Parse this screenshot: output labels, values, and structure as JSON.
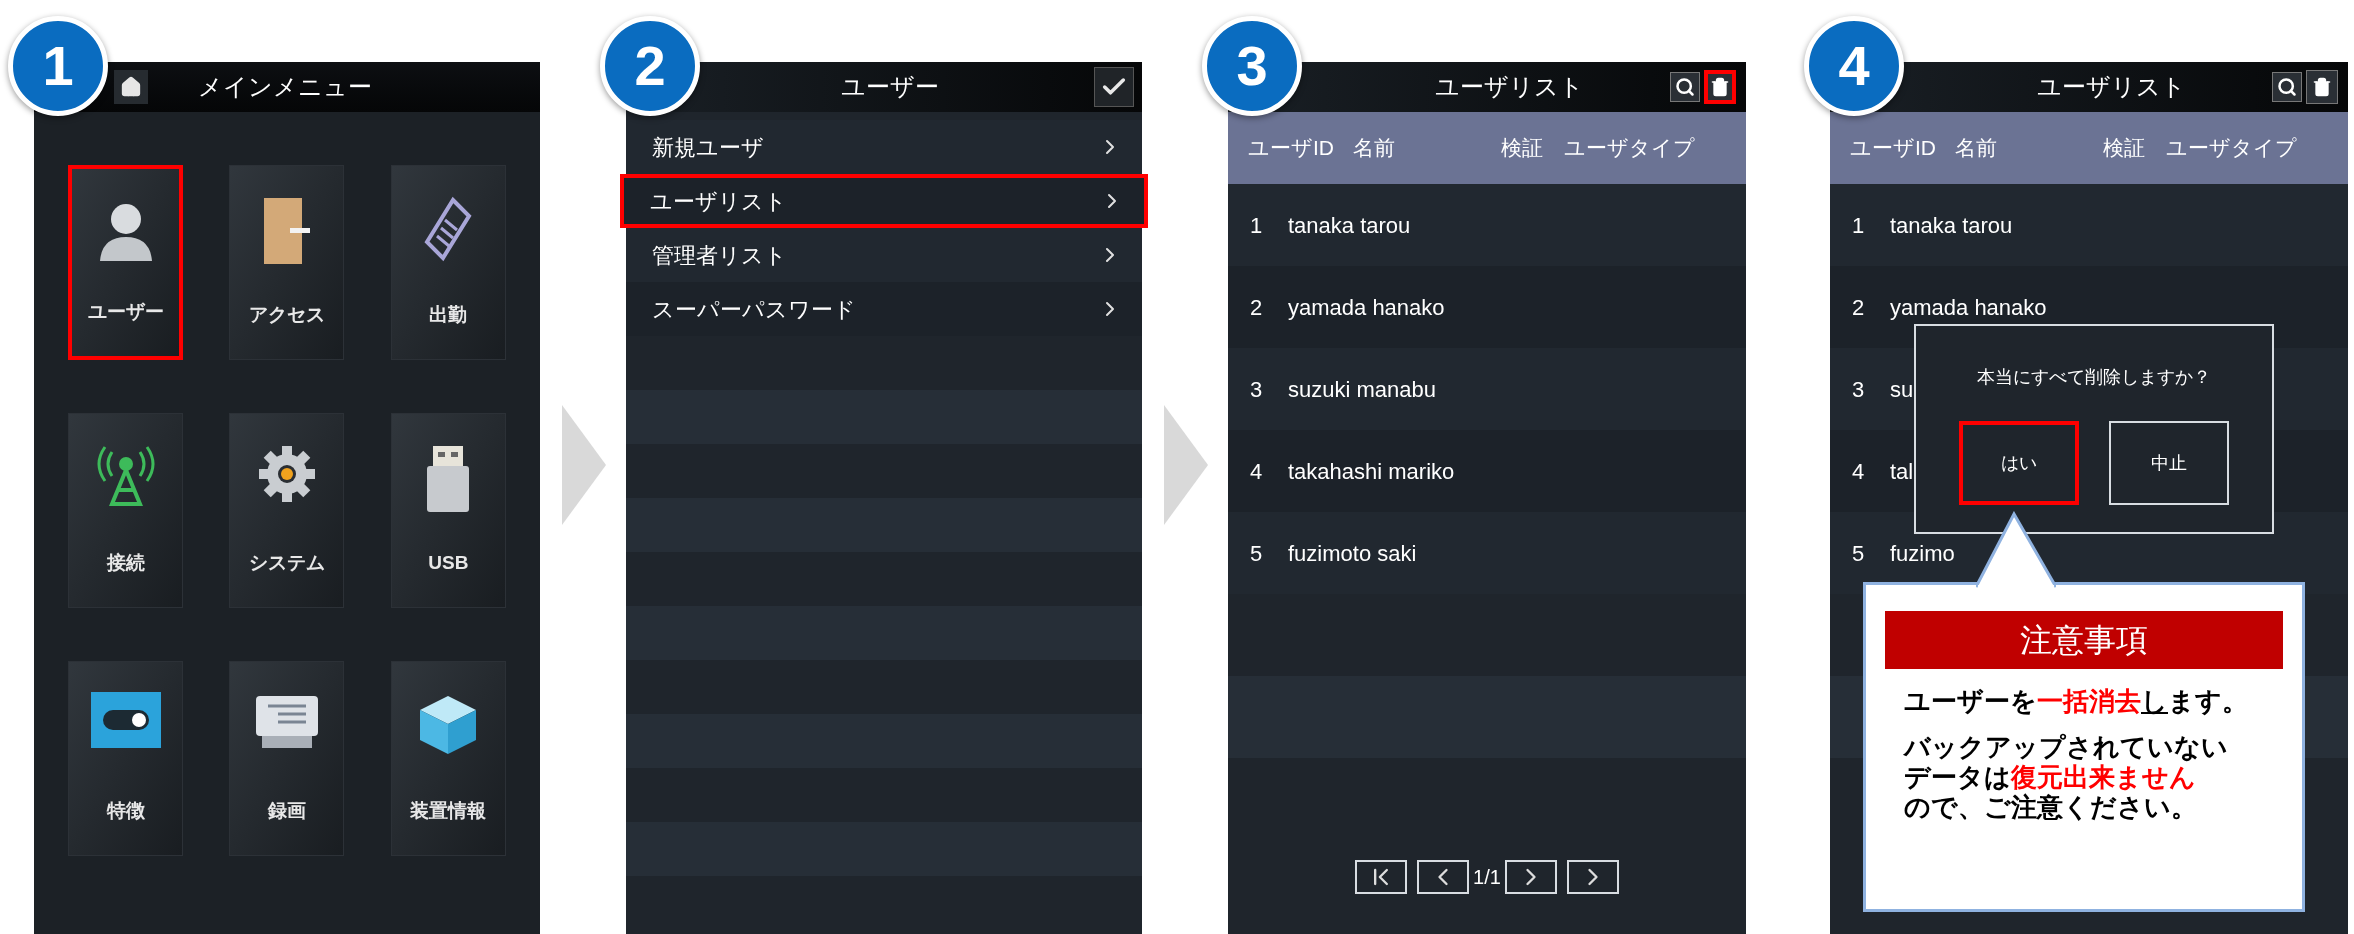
{
  "steps": [
    {
      "number": "1",
      "kind": "main_menu",
      "arrow_after": true,
      "title": "メインメニュー",
      "items": [
        {
          "label": "ユーザー",
          "highlighted": true
        },
        {
          "label": "アクセス",
          "highlighted": false
        },
        {
          "label": "出勤",
          "highlighted": false
        },
        {
          "label": "接続",
          "highlighted": false
        },
        {
          "label": "システム",
          "highlighted": false
        },
        {
          "label": "USB",
          "highlighted": false
        },
        {
          "label": "特徴",
          "highlighted": false
        },
        {
          "label": "録画",
          "highlighted": false
        },
        {
          "label": "装置情報",
          "highlighted": false
        }
      ]
    },
    {
      "number": "2",
      "kind": "submenu",
      "arrow_after": true,
      "title": "ユーザー",
      "items": [
        {
          "label": "新規ユーザ",
          "highlighted": false
        },
        {
          "label": "ユーザリスト",
          "highlighted": true
        },
        {
          "label": "管理者リスト",
          "highlighted": false
        },
        {
          "label": "スーパーパスワード",
          "highlighted": false
        }
      ]
    },
    {
      "number": "3",
      "kind": "user_list",
      "arrow_after": false,
      "title": "ユーザリスト",
      "delete_highlighted": true,
      "columns": [
        "ユーザID",
        "名前",
        "検証",
        "ユーザタイプ"
      ],
      "rows": [
        {
          "id": "1",
          "name": "tanaka tarou"
        },
        {
          "id": "2",
          "name": "yamada hanako"
        },
        {
          "id": "3",
          "name": "suzuki manabu"
        },
        {
          "id": "4",
          "name": "takahashi mariko"
        },
        {
          "id": "5",
          "name": "fuzimoto saki"
        }
      ],
      "page": "1/1"
    },
    {
      "number": "4",
      "kind": "user_list",
      "arrow_after": false,
      "title": "ユーザリスト",
      "delete_highlighted": false,
      "columns": [
        "ユーザID",
        "名前",
        "検証",
        "ユーザタイプ"
      ],
      "rows": [
        {
          "id": "1",
          "name": "tanaka tarou"
        },
        {
          "id": "2",
          "name": "yamada hanako"
        },
        {
          "id": "3",
          "name": "su"
        },
        {
          "id": "4",
          "name": "tal"
        },
        {
          "id": "5",
          "name": "fuzimo"
        }
      ],
      "dialog": {
        "message": "本当にすべて削除しますか？",
        "buttons": [
          {
            "label": "はい",
            "highlighted": true
          },
          {
            "label": "中止",
            "highlighted": false
          }
        ]
      },
      "callout": {
        "title": "注意事項",
        "paragraphs": [
          [
            [
              {
                "text": "ユーザーを",
                "kind": "plain"
              },
              {
                "text": "一括消去",
                "kind": "warning"
              },
              {
                "text": "し",
                "kind": "underlined"
              },
              {
                "text": "ます。",
                "kind": "plain"
              }
            ]
          ],
          [
            [
              {
                "text": "バックアップされていない",
                "kind": "plain"
              }
            ],
            [
              {
                "text": "データは",
                "kind": "plain"
              },
              {
                "text": "復元出来ません",
                "kind": "warning"
              }
            ],
            [
              {
                "text": "ので、ご注意ください。",
                "kind": "plain"
              }
            ]
          ]
        ]
      }
    }
  ]
}
